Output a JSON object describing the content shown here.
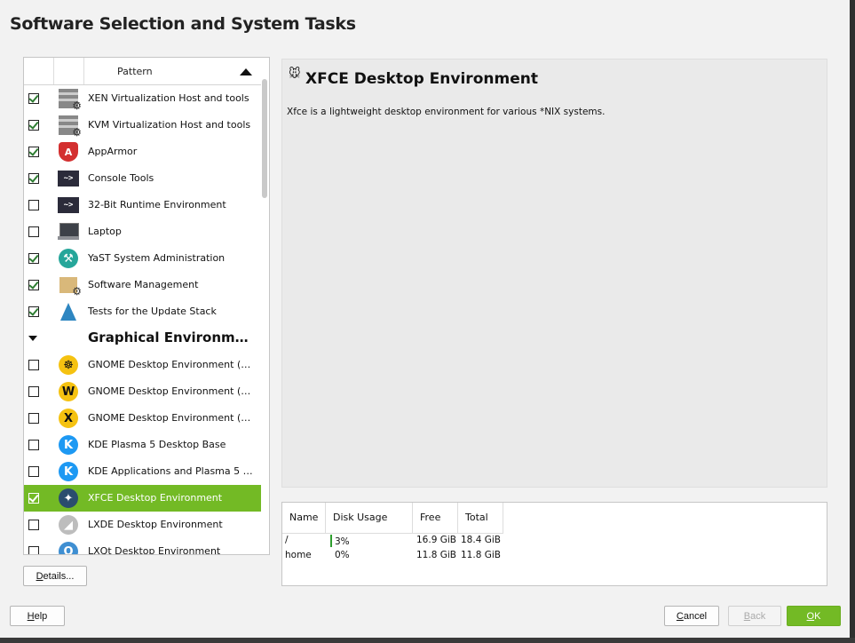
{
  "window": {
    "title": "Software Selection and System Tasks"
  },
  "pattern_table": {
    "header_label": "Pattern",
    "rows": [
      {
        "label": "XEN Virtualization Host and tools",
        "checked": true,
        "icon": "server-gear-icon"
      },
      {
        "label": "KVM Virtualization Host and tools",
        "checked": true,
        "icon": "server-gear-icon"
      },
      {
        "label": "AppArmor",
        "checked": true,
        "icon": "apparmor-shield-icon"
      },
      {
        "label": "Console Tools",
        "checked": true,
        "icon": "terminal-icon"
      },
      {
        "label": "32-Bit Runtime Environment",
        "checked": false,
        "icon": "terminal-icon"
      },
      {
        "label": "Laptop",
        "checked": false,
        "icon": "laptop-icon"
      },
      {
        "label": "YaST System Administration",
        "checked": true,
        "icon": "yast-icon"
      },
      {
        "label": "Software Management",
        "checked": true,
        "icon": "package-gear-icon"
      },
      {
        "label": "Tests for the Update Stack",
        "checked": true,
        "icon": "flask-icon"
      },
      {
        "label": "Graphical Environments",
        "group": true
      },
      {
        "label": "GNOME Desktop Environment (…",
        "checked": false,
        "icon": "gnome-icon"
      },
      {
        "label": "GNOME Desktop Environment (…",
        "checked": false,
        "icon": "gnome-wayland-icon"
      },
      {
        "label": "GNOME Desktop Environment (…",
        "checked": false,
        "icon": "gnome-x11-icon"
      },
      {
        "label": "KDE Plasma 5 Desktop Base",
        "checked": false,
        "icon": "kde-icon"
      },
      {
        "label": "KDE Applications and Plasma 5 …",
        "checked": false,
        "icon": "kde-icon"
      },
      {
        "label": "XFCE Desktop Environment",
        "checked": true,
        "icon": "xfce-icon",
        "selected": true
      },
      {
        "label": "LXDE Desktop Environment",
        "checked": false,
        "icon": "lxde-icon"
      },
      {
        "label": "LXQt Desktop Environment",
        "checked": false,
        "icon": "lxqt-icon"
      }
    ]
  },
  "description": {
    "title": "XFCE Desktop Environment",
    "body": "Xfce is a lightweight desktop environment for various *NIX systems."
  },
  "disk_usage": {
    "headers": {
      "name": "Name",
      "usage": "Disk Usage",
      "free": "Free",
      "total": "Total"
    },
    "rows": [
      {
        "name": "/",
        "usage": "3%",
        "free": "16.9 GiB",
        "total": "18.4 GiB"
      },
      {
        "name": "home",
        "usage": "0%",
        "free": "11.8 GiB",
        "total": "11.8 GiB"
      }
    ]
  },
  "buttons": {
    "details": {
      "pre": "",
      "key": "D",
      "post": "etails..."
    },
    "help": {
      "pre": "",
      "key": "H",
      "post": "elp"
    },
    "cancel": {
      "pre": "",
      "key": "C",
      "post": "ancel"
    },
    "back": {
      "pre": "",
      "key": "B",
      "post": "ack"
    },
    "ok": {
      "pre": "",
      "key": "O",
      "post": "K"
    }
  },
  "colors": {
    "accent": "#73ba25",
    "selected_row_bg": "#73ba25"
  }
}
